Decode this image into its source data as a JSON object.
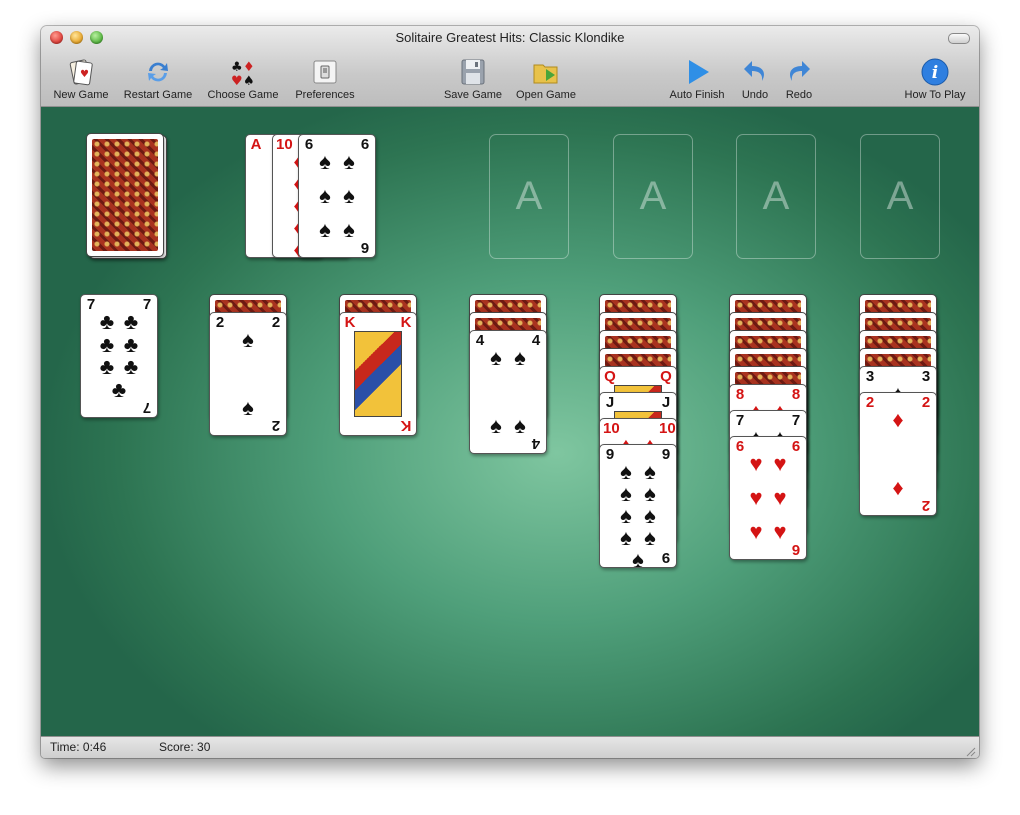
{
  "window": {
    "title": "Solitaire Greatest Hits: Classic Klondike"
  },
  "toolbar": {
    "new_game": "New Game",
    "restart_game": "Restart Game",
    "choose_game": "Choose Game",
    "preferences": "Preferences",
    "save_game": "Save Game",
    "open_game": "Open Game",
    "auto_finish": "Auto Finish",
    "undo": "Undo",
    "redo": "Redo",
    "how_to_play": "How To Play"
  },
  "icons": {
    "new_game": "cards-icon",
    "restart_game": "recycle-arrows-icon",
    "choose_game": "card-suits-icon",
    "preferences": "switch-icon",
    "save_game": "floppy-disk-icon",
    "open_game": "folder-icon",
    "auto_finish": "play-arrow-icon",
    "undo": "undo-arrow-icon",
    "redo": "redo-arrow-icon",
    "how_to_play": "info-icon"
  },
  "foundations": [
    {
      "label": "A"
    },
    {
      "label": "A"
    },
    {
      "label": "A"
    },
    {
      "label": "A"
    }
  ],
  "waste": [
    {
      "rank": "A",
      "suit": "♦"
    },
    {
      "rank": "10",
      "suit": "♦"
    },
    {
      "rank": "6",
      "suit": "♠"
    }
  ],
  "tableau": [
    {
      "face_down": 0,
      "cards": [
        {
          "rank": "7",
          "suit": "♣"
        }
      ]
    },
    {
      "face_down": 1,
      "cards": [
        {
          "rank": "2",
          "suit": "♠"
        }
      ]
    },
    {
      "face_down": 1,
      "cards": [
        {
          "rank": "K",
          "suit": "♦"
        }
      ]
    },
    {
      "face_down": 2,
      "cards": [
        {
          "rank": "4",
          "suit": "♠"
        }
      ]
    },
    {
      "face_down": 4,
      "cards": [
        {
          "rank": "Q",
          "suit": "♦"
        },
        {
          "rank": "J",
          "suit": "♠"
        },
        {
          "rank": "10",
          "suit": "♦"
        },
        {
          "rank": "9",
          "suit": "♠"
        }
      ]
    },
    {
      "face_down": 5,
      "cards": [
        {
          "rank": "8",
          "suit": "♦"
        },
        {
          "rank": "7",
          "suit": "♠"
        },
        {
          "rank": "6",
          "suit": "♥"
        }
      ]
    },
    {
      "face_down": 4,
      "cards": [
        {
          "rank": "3",
          "suit": "♠"
        },
        {
          "rank": "2",
          "suit": "♦"
        }
      ]
    }
  ],
  "status": {
    "time": "Time: 0:46",
    "score": "Score: 30"
  },
  "colors": {
    "felt": "#3f8c66",
    "red_suit": "#d41414",
    "black_suit": "#111111"
  }
}
